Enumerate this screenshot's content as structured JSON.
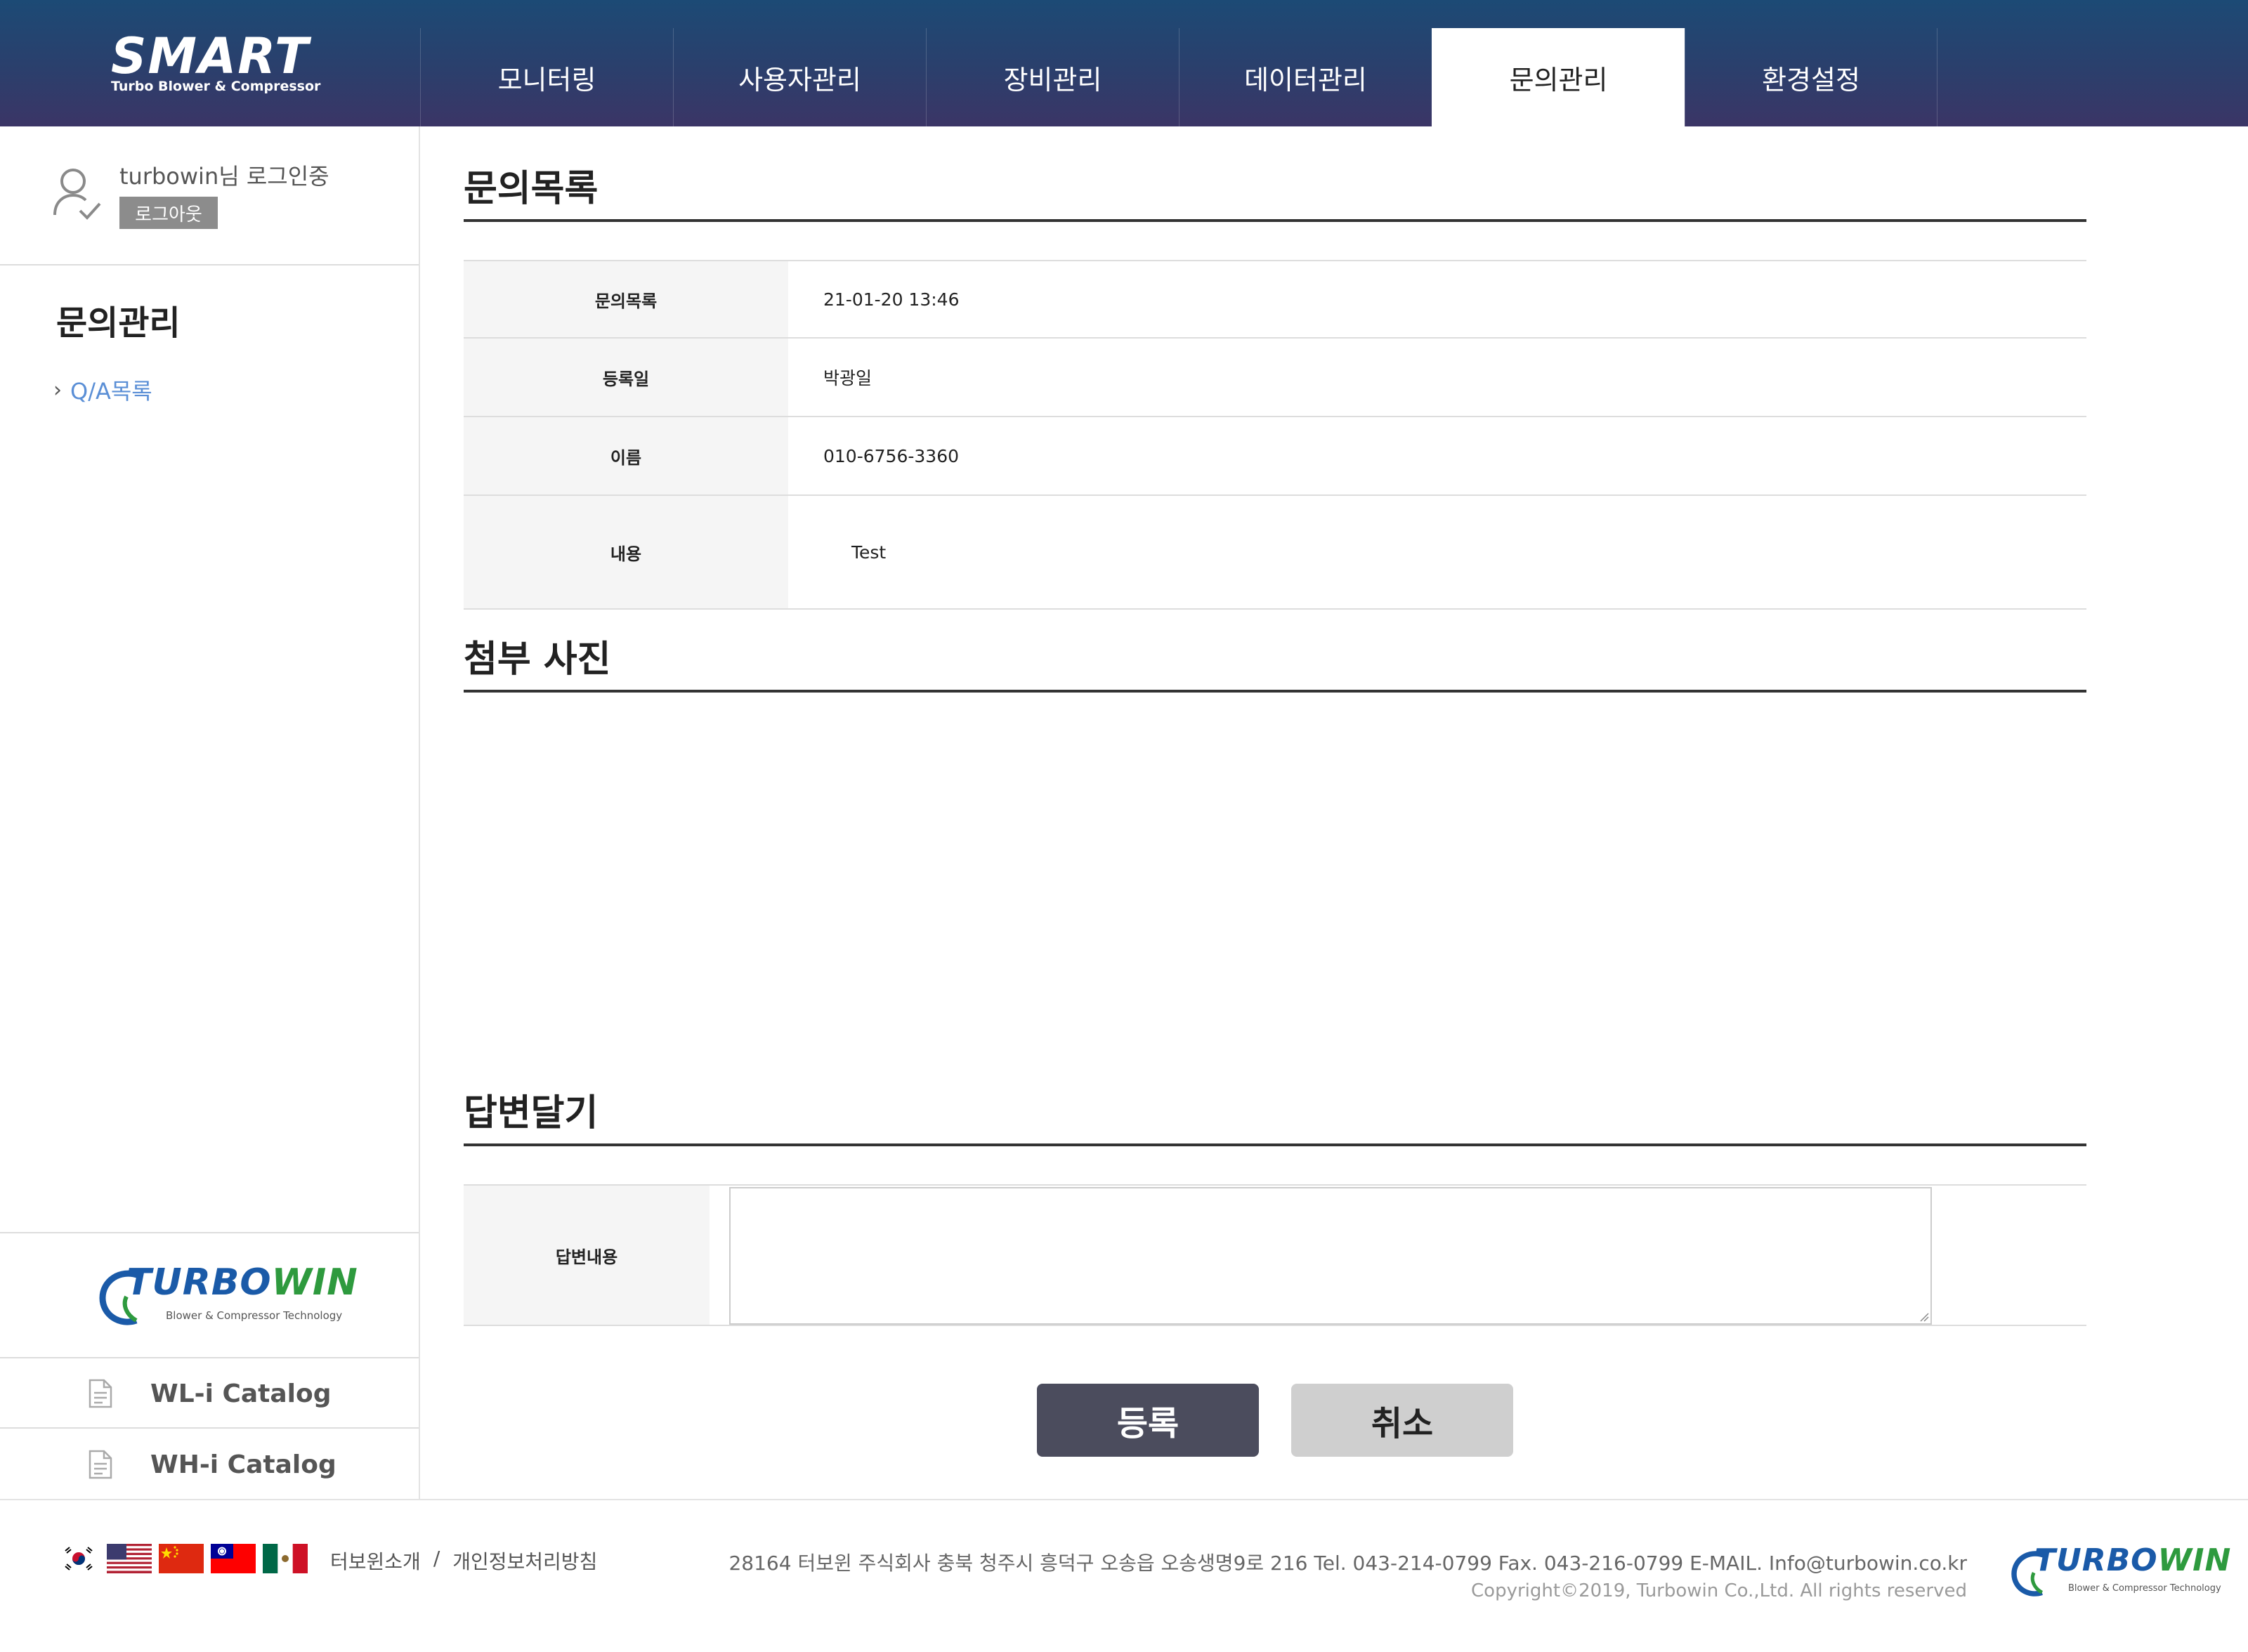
{
  "header": {
    "logo_text": "SMART",
    "logo_sub": "Turbo Blower & Compressor",
    "tabs": [
      {
        "label": "모니터링"
      },
      {
        "label": "사용자관리"
      },
      {
        "label": "장비관리"
      },
      {
        "label": "데이터관리"
      },
      {
        "label": "문의관리",
        "active": true
      },
      {
        "label": "환경설정"
      }
    ]
  },
  "sidebar": {
    "user_text": "turbowin님 로그인중",
    "logout_label": "로그아웃",
    "section_title": "문의관리",
    "items": [
      {
        "label": "Q/A목록"
      }
    ],
    "brand": {
      "name_blue": "TURBO",
      "name_green": "WIN",
      "tagline": "Blower & Compressor Technology"
    },
    "catalogs": [
      {
        "label": "WL-i Catalog"
      },
      {
        "label": "WH-i Catalog"
      }
    ]
  },
  "main": {
    "list_title": "문의목록",
    "rows": [
      {
        "label": "문의목록",
        "value": "21-01-20 13:46"
      },
      {
        "label": "등록일",
        "value": "박광일"
      },
      {
        "label": "이름",
        "value": "010-6756-3360"
      },
      {
        "label": "내용",
        "value": "Test"
      }
    ],
    "photo_title": "첨부 사진",
    "reply_title": "답변달기",
    "reply_label": "답변내용",
    "reply_value": "",
    "submit_label": "등록",
    "cancel_label": "취소"
  },
  "footer": {
    "links": [
      "터보윈소개",
      "/",
      "개인정보처리방침"
    ],
    "address": "28164 터보윈 주식회사 충북 청주시 흥덕구 오송읍 오송생명9로 216    Tel. 043-214-0799    Fax. 043-216-0799    E-MAIL. Info@turbowin.co.kr",
    "copyright": "Copyright©2019, Turbowin Co.,Ltd. All rights reserved",
    "flags": [
      "korea-flag",
      "usa-flag",
      "china-flag",
      "taiwan-flag",
      "mexico-flag"
    ]
  },
  "colors": {
    "header_top": "#1c4a75",
    "header_bottom": "#3b3566",
    "sidebar_link": "#5b8fd6",
    "submit_button": "#4b4c5d",
    "cancel_button": "#cfcfcf",
    "brand_blue": "#1a5aa8",
    "brand_green": "#2e9a3e"
  }
}
